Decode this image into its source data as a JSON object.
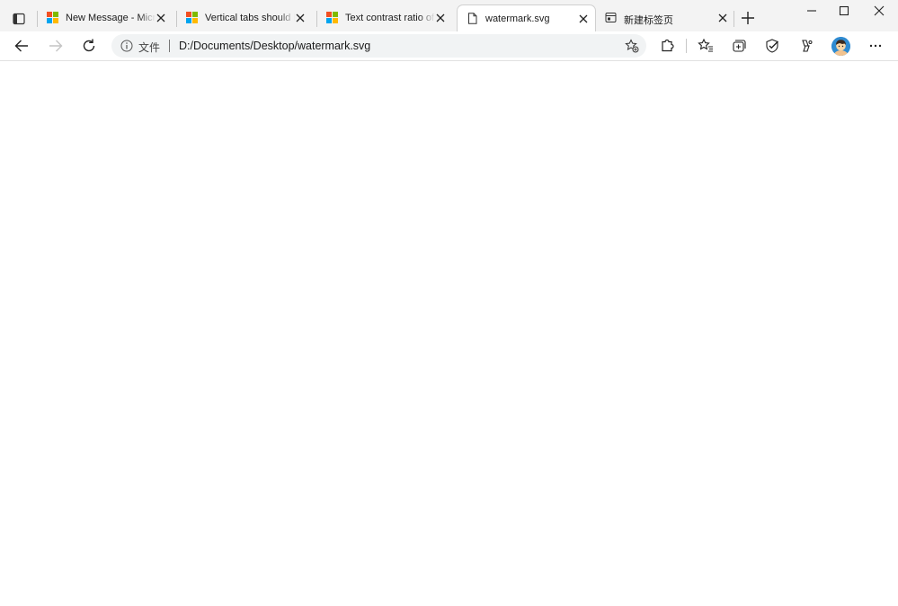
{
  "tabs": [
    {
      "title": "New Message - Microsoft Outlook",
      "favicon": "microsoft-logo",
      "active": false
    },
    {
      "title": "Vertical tabs should be available",
      "favicon": "microsoft-logo",
      "active": false
    },
    {
      "title": "Text contrast ratio of UI",
      "favicon": "microsoft-logo",
      "active": false
    },
    {
      "title": "watermark.svg",
      "favicon": "file-icon",
      "active": true
    },
    {
      "title": "新建标签页",
      "favicon": "newtab-icon",
      "active": false
    }
  ],
  "address_bar": {
    "scheme_label": "文件",
    "url": "D:/Documents/Desktop/watermark.svg"
  },
  "colors": {
    "ms_red": "#f25022",
    "ms_green": "#7fba00",
    "ms_blue": "#00a4ef",
    "ms_yellow": "#ffb900",
    "strip_bg": "#f3f3f3",
    "avatar_bg": "#2f8bd1"
  },
  "icons": [
    "tab-actions-icon",
    "close-icon",
    "new-tab-icon",
    "minimize-icon",
    "maximize-icon",
    "window-close-icon",
    "back-icon",
    "forward-icon",
    "refresh-icon",
    "info-icon",
    "add-favorite-icon",
    "extensions-icon",
    "favorites-icon",
    "collections-icon",
    "browser-essentials-icon",
    "copilot-icon",
    "profile-avatar",
    "more-icon"
  ]
}
